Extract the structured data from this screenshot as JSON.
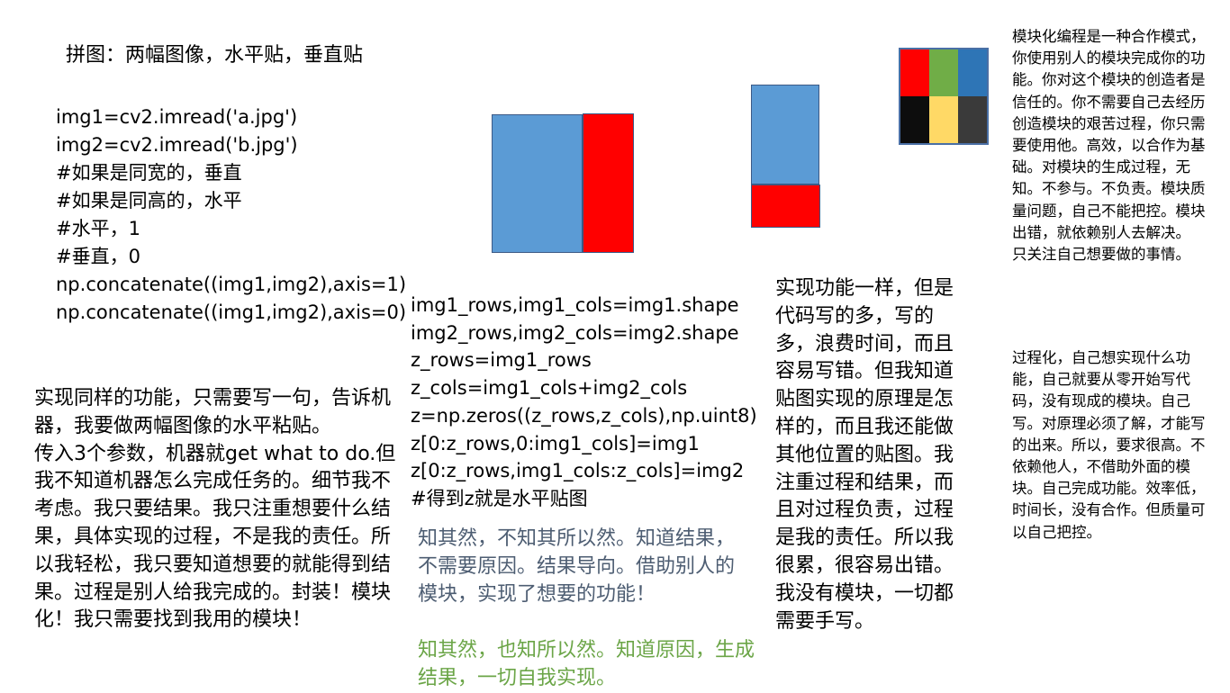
{
  "title": "拼图：两幅图像，水平贴，垂直贴",
  "code_left": [
    "img1=cv2.imread('a.jpg')",
    "img2=cv2.imread('b.jpg')",
    "#如果是同宽的，垂直",
    "#如果是同高的，水平",
    "#水平，1",
    "#垂直，0",
    "np.concatenate((img1,img2),axis=1)",
    "np.concatenate((img1,img2),axis=0)"
  ],
  "note_left": "实现同样的功能，只需要写一句，告诉机器，我要做两幅图像的水平粘贴。\n传入3个参数，机器就get what to do.但我不知道机器怎么完成任务的。细节我不考虑。我只要结果。我只注重想要什么结果，具体实现的过程，不是我的责任。所以我轻松，我只要知道想要的就能得到结果。过程是别人给我完成的。封装！模块化！我只需要找到我用的模块！",
  "code_mid": [
    "img1_rows,img1_cols=img1.shape",
    "img2_rows,img2_cols=img2.shape",
    "z_rows=img1_rows",
    "z_cols=img1_cols+img2_cols",
    "z=np.zeros((z_rows,z_cols),np.uint8)",
    "z[0:z_rows,0:img1_cols]=img1",
    "z[0:z_rows,img1_cols:z_cols]=img2",
    "#得到z就是水平贴图"
  ],
  "gray_note": "知其然，不知其所以然。知道结果，不需要原因。结果导向。借助别人的模块，实现了想要的功能！",
  "green_note": "知其然，也知所以然。知道原因，生成结果，一切自我实现。",
  "note_right": "实现功能一样，但是代码写的多，写的多，浪费时间，而且容易写错。但我知道贴图实现的原理是怎样的，而且我还能做其他位置的贴图。我注重过程和结果，而且对过程负责，过程是我的责任。所以我很累，很容易出错。我没有模块，一切都需要手写。",
  "side_note_1": "模块化编程是一种合作模式，你使用别人的模块完成你的功能。你对这个模块的创造者是信任的。你不需要自己去经历创造模块的艰苦过程，你只需要使用他。高效，以合作为基础。对模块的生成过程，无知。不参与。不负责。模块质量问题，自己不能把控。模块出错，就依赖别人去解决。\n只关注自己想要做的事情。",
  "side_note_2": "过程化，自己想实现什么功能，自己就要从零开始写代码，没有现成的模块。自己写。对原理必须了解，才能写的出来。所以，要求很高。不依赖他人，不借助外面的模块。自己完成功能。效率低，时间长，没有合作。但质量可以自己把控。",
  "colors": {
    "blue": "#5b9bd5",
    "red": "#ff0000",
    "grid_cells": [
      "#ff0000",
      "#70ad47",
      "#2e75b6",
      "#0d0d0d",
      "#ffd966",
      "#3a3a3a"
    ],
    "gray_text": "#4d5d72",
    "green_text": "#6ba547"
  }
}
